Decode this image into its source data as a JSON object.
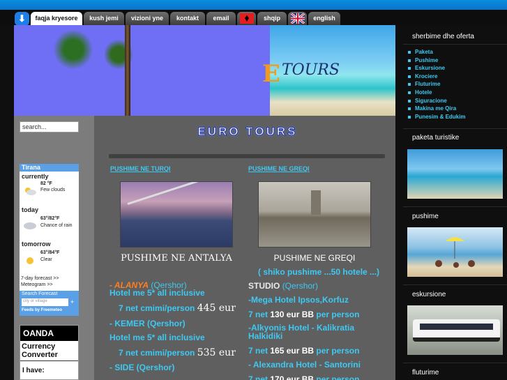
{
  "nav": {
    "tabs": [
      "faqja kryesore",
      "kush jemi",
      "vizioni yne",
      "kontakt",
      "email"
    ],
    "lang_albanian": "shqip",
    "lang_english": "english"
  },
  "left": {
    "search_value": "search...",
    "weather": {
      "city": "Tirana",
      "currently_label": "currently",
      "currently_temp": "82 °F",
      "currently_desc": "Few clouds",
      "today_label": "today",
      "today_temp": "63°/82°F",
      "today_desc": "Chance of rain",
      "tomorrow_label": "tomorrow",
      "tomorrow_temp": "63°/84°F",
      "tomorrow_desc": "Clear",
      "forecast_link": "7-day forecast >>",
      "meteogram_link": "Meteogram >>",
      "search_forecast": "Search Forecast",
      "search_placeholder": "city or village",
      "feeds_by": "Feeds by Freemeteo"
    },
    "oanda": {
      "brand": "OANDA",
      "title": "Currency Converter",
      "have": "I have:"
    }
  },
  "banner": {
    "logo_letter": "E",
    "logo_word": "TOURS"
  },
  "main": {
    "site_title": "EURO TOURS",
    "col1": {
      "head": "PUSHIME NE TURQI",
      "caption": "PUSHIME NE ANTALYA",
      "l1_orange": "- ALANYA",
      "l1_cyan": "(Qershor)",
      "l2": "Hotel me 5* all inclusive",
      "l3_cyan": "7 net cmimi/person",
      "l3_price": "445 eur",
      "l4": "- KEMER (Qershor)",
      "l5": "Hotel me 5* all inclusive",
      "l6_cyan": "7 net cmimi/person",
      "l6_price": "535 eur",
      "l7": "- SIDE (Qershor)"
    },
    "col2": {
      "head": "PUSHIME NE GREQI",
      "caption": "PUSHIME NE GREQI",
      "l1": "( shiko pushime ...50 hotele ...)",
      "l2_white": "STUDIO",
      "l2_cyan": "(Qershor)",
      "l3": "-Mega Hotel Ipsos,Korfuz",
      "l4_a": "7 net",
      "l4_b": "130 eur BB",
      "l4_c": "per person",
      "l5": "-Alkyonis Hotel - Kalikratia Halkidiki",
      "l6_a": "7 net",
      "l6_b": "165 eur BB",
      "l6_c": "per person",
      "l7": "- Alexandra Hotel - Santorini",
      "l8_a": "7 net",
      "l8_b": "170 eur BB",
      "l8_c": "per person"
    }
  },
  "right": {
    "services_title": "sherbime dhe oferta",
    "services": [
      "Paketa",
      "Pushime",
      "Eskursione",
      "Krociere",
      "Fluturime",
      "Hotele",
      "Siguracione",
      "Makina me Qira",
      "Punesim & Edukim"
    ],
    "packages_title": "paketa turistike",
    "holidays_title": "pushime",
    "excursions_title": "eskursione",
    "flights_title": "fluturime"
  }
}
